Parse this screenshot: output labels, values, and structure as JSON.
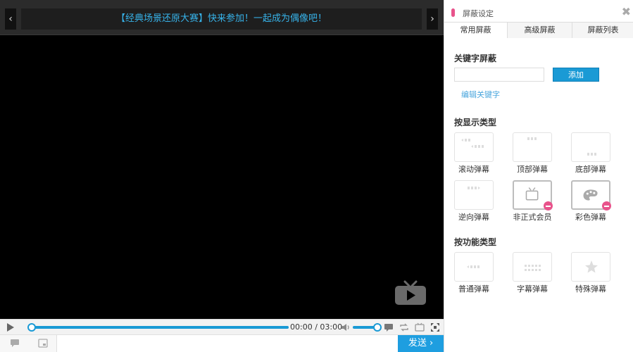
{
  "player": {
    "announcement": "【经典场景还原大赛】快来参加！一起成为偶像吧！",
    "prev_label": "‹",
    "next_label": "›",
    "progress_fraction": 1.0,
    "time_current": "00:00",
    "time_separator": "/",
    "time_total": "03:00",
    "volume_fraction": 0.85,
    "send_label": "发送 ›",
    "accent": "#1a9ad5"
  },
  "panel": {
    "title": "屏蔽设定",
    "close_label": "✖",
    "tabs": [
      {
        "label": "常用屏蔽",
        "active": true
      },
      {
        "label": "高级屏蔽",
        "active": false
      },
      {
        "label": "屏蔽列表",
        "active": false
      }
    ],
    "keyword": {
      "heading": "关键字屏蔽",
      "input_value": "",
      "add_label": "添加",
      "edit_label": "编辑关键字"
    },
    "display_types": {
      "heading": "按显示类型",
      "items": [
        {
          "label": "滚动弹幕",
          "icon": "scroll-danmaku-icon",
          "blocked": false
        },
        {
          "label": "顶部弹幕",
          "icon": "top-danmaku-icon",
          "blocked": false
        },
        {
          "label": "底部弹幕",
          "icon": "bottom-danmaku-icon",
          "blocked": false
        },
        {
          "label": "逆向弹幕",
          "icon": "reverse-danmaku-icon",
          "blocked": false
        },
        {
          "label": "非正式会员",
          "icon": "tv-icon",
          "blocked": true
        },
        {
          "label": "彩色弹幕",
          "icon": "palette-icon",
          "blocked": true
        }
      ]
    },
    "function_types": {
      "heading": "按功能类型",
      "items": [
        {
          "label": "普通弹幕",
          "icon": "normal-danmaku-icon",
          "blocked": false
        },
        {
          "label": "字幕弹幕",
          "icon": "subtitle-danmaku-icon",
          "blocked": false
        },
        {
          "label": "特殊弹幕",
          "icon": "star-icon",
          "blocked": false
        }
      ]
    },
    "accent_pink": "#e8538b"
  }
}
